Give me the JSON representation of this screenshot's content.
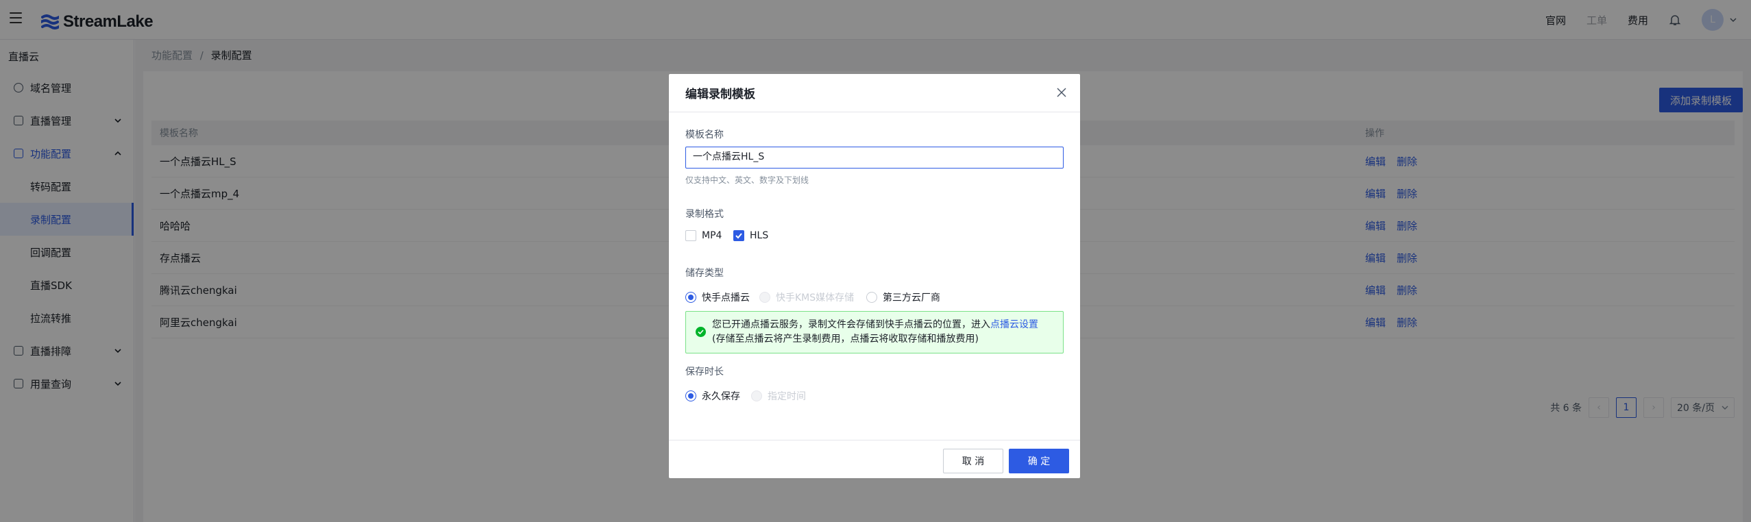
{
  "header": {
    "logo_text": "StreamLake",
    "links": [
      "官网",
      "工单",
      "费用"
    ],
    "avatar_initial": "L",
    "brand_color": "#2d5be3"
  },
  "sidebar": {
    "title": "直播云",
    "items": [
      {
        "label": "域名管理",
        "icon": "globe-icon"
      },
      {
        "label": "直播管理",
        "icon": "video-icon"
      },
      {
        "label": "功能配置",
        "icon": "config-icon"
      },
      {
        "label": "转码配置"
      },
      {
        "label": "录制配置"
      },
      {
        "label": "回调配置"
      },
      {
        "label": "直播SDK"
      },
      {
        "label": "拉流转推"
      },
      {
        "label": "直播排障",
        "icon": "troubleshoot-icon"
      },
      {
        "label": "用量查询",
        "icon": "usage-icon"
      }
    ]
  },
  "breadcrumb": {
    "parent": "功能配置",
    "sep": "/",
    "current": "录制配置"
  },
  "main": {
    "add_button": "添加录制模板",
    "table": {
      "headers": [
        "模板名称",
        "操作"
      ],
      "rows": [
        {
          "name": "一个点播云HL_S"
        },
        {
          "name": "一个点播云mp_4"
        },
        {
          "name": "哈哈哈"
        },
        {
          "name": "存点播云"
        },
        {
          "name": "腾讯云chengkai"
        },
        {
          "name": "阿里云chengkai"
        }
      ],
      "edit_label": "编辑",
      "delete_label": "删除"
    },
    "pagination": {
      "total": "共 6 条",
      "current_page": "1",
      "page_size": "20 条/页"
    }
  },
  "modal": {
    "title": "编辑录制模板",
    "name_label": "模板名称",
    "name_value": "一个点播云HL_S",
    "name_hint": "仅支持中文、英文、数字及下划线",
    "format_label": "录制格式",
    "formats": [
      {
        "label": "MP4",
        "checked": false
      },
      {
        "label": "HLS",
        "checked": true
      }
    ],
    "storage_label": "储存类型",
    "storage_options": [
      {
        "label": "快手点播云",
        "selected": true,
        "disabled": false
      },
      {
        "label": "快手KMS媒体存储",
        "selected": false,
        "disabled": true
      },
      {
        "label": "第三方云厂商",
        "selected": false,
        "disabled": false
      }
    ],
    "alert_line1": "您已开通点播云服务，录制文件会存储到快手点播云的位置，进入",
    "alert_link": "点播云设置",
    "alert_line2": "(存储至点播云将产生录制费用，点播云将收取存储和播放费用)",
    "duration_label": "保存时长",
    "duration_options": [
      {
        "label": "永久保存",
        "selected": true,
        "disabled": false
      },
      {
        "label": "指定时间",
        "selected": false,
        "disabled": true
      }
    ],
    "cancel_label": "取 消",
    "confirm_label": "确 定"
  }
}
